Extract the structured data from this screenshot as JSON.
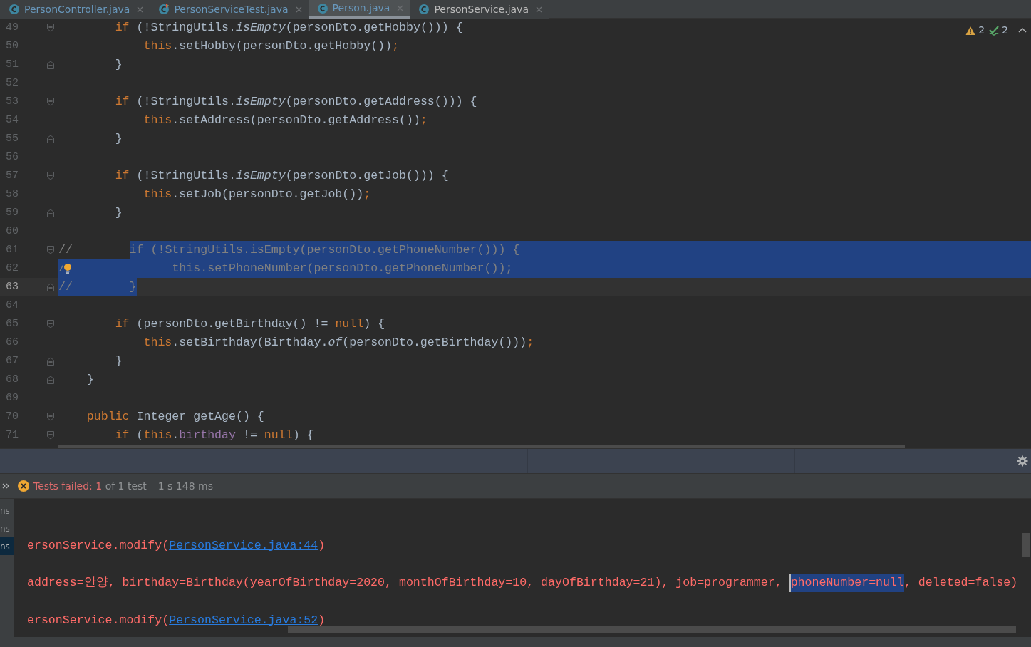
{
  "tabs": [
    {
      "label": "PersonController.java",
      "selected": false,
      "modified": true,
      "test": false
    },
    {
      "label": "PersonServiceTest.java",
      "selected": false,
      "modified": true,
      "test": true
    },
    {
      "label": "Person.java",
      "selected": true,
      "modified": true,
      "test": false
    },
    {
      "label": "PersonService.java",
      "selected": false,
      "modified": false,
      "test": false
    }
  ],
  "inspections": {
    "warnings": "2",
    "weak_warnings": "2"
  },
  "editor": {
    "lines": [
      {
        "number": "49",
        "fold_start": true,
        "fold_end": false,
        "current": false,
        "bulb": false,
        "selection_extends": false,
        "segments": [
          {
            "kind": "kw",
            "text": "        if"
          },
          {
            "kind": "plain",
            "text": " (!StringUtils."
          },
          {
            "kind": "italic",
            "text": "isEmpty"
          },
          {
            "kind": "plain",
            "text": "(personDto.getHobby())) {"
          }
        ]
      },
      {
        "number": "50",
        "fold_start": false,
        "fold_end": false,
        "current": false,
        "bulb": false,
        "selection_extends": false,
        "segments": [
          {
            "kind": "kw",
            "text": "            this"
          },
          {
            "kind": "plain",
            "text": ".setHobby(personDto.getHobby())"
          },
          {
            "kind": "kw",
            "text": ";"
          }
        ]
      },
      {
        "number": "51",
        "fold_start": false,
        "fold_end": true,
        "current": false,
        "bulb": false,
        "selection_extends": false,
        "segments": [
          {
            "kind": "plain",
            "text": "        }"
          }
        ]
      },
      {
        "number": "52",
        "fold_start": false,
        "fold_end": false,
        "current": false,
        "bulb": false,
        "selection_extends": false
      },
      {
        "number": "53",
        "fold_start": true,
        "fold_end": false,
        "current": false,
        "bulb": false,
        "selection_extends": false,
        "segments": [
          {
            "kind": "kw",
            "text": "        if"
          },
          {
            "kind": "plain",
            "text": " (!StringUtils."
          },
          {
            "kind": "italic",
            "text": "isEmpty"
          },
          {
            "kind": "plain",
            "text": "(personDto.getAddress())) {"
          }
        ]
      },
      {
        "number": "54",
        "fold_start": false,
        "fold_end": false,
        "current": false,
        "bulb": false,
        "selection_extends": false,
        "segments": [
          {
            "kind": "kw",
            "text": "            this"
          },
          {
            "kind": "plain",
            "text": ".setAddress(personDto.getAddress())"
          },
          {
            "kind": "kw",
            "text": ";"
          }
        ]
      },
      {
        "number": "55",
        "fold_start": false,
        "fold_end": true,
        "current": false,
        "bulb": false,
        "selection_extends": false,
        "segments": [
          {
            "kind": "plain",
            "text": "        }"
          }
        ]
      },
      {
        "number": "56",
        "fold_start": false,
        "fold_end": false,
        "current": false,
        "bulb": false,
        "selection_extends": false
      },
      {
        "number": "57",
        "fold_start": true,
        "fold_end": false,
        "current": false,
        "bulb": false,
        "selection_extends": false,
        "segments": [
          {
            "kind": "kw",
            "text": "        if"
          },
          {
            "kind": "plain",
            "text": " (!StringUtils."
          },
          {
            "kind": "italic",
            "text": "isEmpty"
          },
          {
            "kind": "plain",
            "text": "(personDto.getJob())) {"
          }
        ]
      },
      {
        "number": "58",
        "fold_start": false,
        "fold_end": false,
        "current": false,
        "bulb": false,
        "selection_extends": false,
        "segments": [
          {
            "kind": "kw",
            "text": "            this"
          },
          {
            "kind": "plain",
            "text": ".setJob(personDto.getJob())"
          },
          {
            "kind": "kw",
            "text": ";"
          }
        ]
      },
      {
        "number": "59",
        "fold_start": false,
        "fold_end": true,
        "current": false,
        "bulb": false,
        "selection_extends": false,
        "segments": [
          {
            "kind": "plain",
            "text": "        }"
          }
        ]
      },
      {
        "number": "60",
        "fold_start": false,
        "fold_end": false,
        "current": false,
        "bulb": false,
        "selection_extends": false
      },
      {
        "number": "61",
        "fold_start": true,
        "fold_end": false,
        "current": false,
        "bulb": false,
        "selection_extends": true,
        "segments": [
          {
            "kind": "comment",
            "text": "//        ",
            "selected": false
          },
          {
            "kind": "comment",
            "text": "if (!StringUtils.isEmpty(personDto.getPhoneNumber())) {",
            "selected": true
          }
        ]
      },
      {
        "number": "62",
        "fold_start": false,
        "fold_end": false,
        "current": false,
        "bulb": true,
        "selection_extends": true,
        "segments": [
          {
            "kind": "comment",
            "text": "/",
            "selected": true
          },
          {
            "kind": "comment",
            "text": "              this.setPhoneNumber(personDto.getPhoneNumber());",
            "selected": true
          }
        ]
      },
      {
        "number": "63",
        "fold_start": false,
        "fold_end": true,
        "current": true,
        "bulb": false,
        "selection_extends": false,
        "segments": [
          {
            "kind": "comment",
            "text": "//        }",
            "selected": true
          }
        ]
      },
      {
        "number": "64",
        "fold_start": false,
        "fold_end": false,
        "current": false,
        "bulb": false,
        "selection_extends": false
      },
      {
        "number": "65",
        "fold_start": true,
        "fold_end": false,
        "current": false,
        "bulb": false,
        "selection_extends": false,
        "segments": [
          {
            "kind": "kw",
            "text": "        if"
          },
          {
            "kind": "plain",
            "text": " (personDto.getBirthday() != "
          },
          {
            "kind": "kw",
            "text": "null"
          },
          {
            "kind": "plain",
            "text": ") {"
          }
        ]
      },
      {
        "number": "66",
        "fold_start": false,
        "fold_end": false,
        "current": false,
        "bulb": false,
        "selection_extends": false,
        "segments": [
          {
            "kind": "kw",
            "text": "            this"
          },
          {
            "kind": "plain",
            "text": ".setBirthday(Birthday."
          },
          {
            "kind": "italic",
            "text": "of"
          },
          {
            "kind": "plain",
            "text": "(personDto.getBirthday()))"
          },
          {
            "kind": "kw",
            "text": ";"
          }
        ]
      },
      {
        "number": "67",
        "fold_start": false,
        "fold_end": true,
        "current": false,
        "bulb": false,
        "selection_extends": false,
        "segments": [
          {
            "kind": "plain",
            "text": "        }"
          }
        ]
      },
      {
        "number": "68",
        "fold_start": false,
        "fold_end": true,
        "current": false,
        "bulb": false,
        "selection_extends": false,
        "segments": [
          {
            "kind": "plain",
            "text": "    }"
          }
        ]
      },
      {
        "number": "69",
        "fold_start": false,
        "fold_end": false,
        "current": false,
        "bulb": false,
        "selection_extends": false
      },
      {
        "number": "70",
        "fold_start": true,
        "fold_end": false,
        "current": false,
        "bulb": false,
        "selection_extends": false,
        "segments": [
          {
            "kind": "kw",
            "text": "    public"
          },
          {
            "kind": "plain",
            "text": " Integer "
          },
          {
            "kind": "method",
            "text": "getAge"
          },
          {
            "kind": "plain",
            "text": "() {"
          }
        ]
      },
      {
        "number": "71",
        "fold_start": true,
        "fold_end": false,
        "current": false,
        "bulb": false,
        "selection_extends": false,
        "segments": [
          {
            "kind": "kw",
            "text": "        if"
          },
          {
            "kind": "plain",
            "text": " ("
          },
          {
            "kind": "kw",
            "text": "this"
          },
          {
            "kind": "plain",
            "text": "."
          },
          {
            "kind": "field",
            "text": "birthday"
          },
          {
            "kind": "plain",
            "text": " != "
          },
          {
            "kind": "kw",
            "text": "null"
          },
          {
            "kind": "plain",
            "text": ") {"
          }
        ]
      }
    ]
  },
  "run": {
    "status_segments": [
      {
        "kind": "fail",
        "text": "Tests failed: 1"
      },
      {
        "kind": "info",
        "text": " of 1 test – 1 s 148 ms"
      }
    ],
    "side_items": [
      {
        "label": "ns",
        "selected": false
      },
      {
        "label": "ns",
        "selected": false
      },
      {
        "label": "ns",
        "selected": true
      }
    ],
    "console_lines": [
      {
        "segments": [
          {
            "kind": "error",
            "text": "ersonService.modify(",
            "selected": false,
            "caret": false
          },
          {
            "kind": "link",
            "text": "PersonService.java:44",
            "selected": false,
            "caret": false
          },
          {
            "kind": "error",
            "text": ")",
            "selected": false,
            "caret": false
          }
        ]
      },
      {
        "segments": [
          {
            "kind": "error",
            "text": "address=안양, birthday=Birthday(yearOfBirthday=2020, monthOfBirthday=10, dayOfBirthday=21), job=programmer, ",
            "selected": false,
            "caret": false
          },
          {
            "kind": "error",
            "text": "phoneNumber=null",
            "selected": true,
            "caret": true
          },
          {
            "kind": "error",
            "text": ", deleted=false)",
            "selected": false,
            "caret": false
          }
        ]
      },
      {
        "segments": [
          {
            "kind": "error",
            "text": "ersonService.modify(",
            "selected": false,
            "caret": false
          },
          {
            "kind": "link",
            "text": "PersonService.java:52",
            "selected": false,
            "caret": false
          },
          {
            "kind": "error",
            "text": ")",
            "selected": false,
            "caret": false
          }
        ]
      }
    ]
  }
}
